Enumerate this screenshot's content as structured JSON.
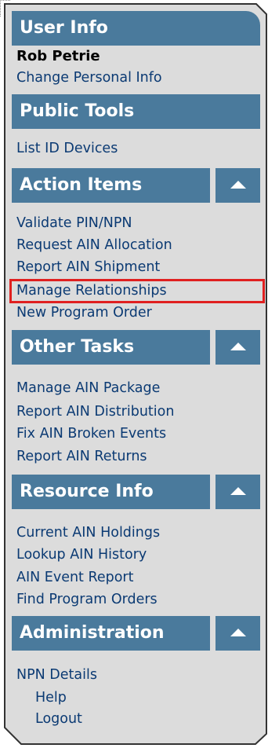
{
  "sections": {
    "user_info": {
      "title": "User Info",
      "user_name": "Rob Petrie",
      "links": [
        "Change Personal Info"
      ]
    },
    "public_tools": {
      "title": "Public Tools",
      "links": [
        "List ID Devices"
      ]
    },
    "action_items": {
      "title": "Action Items",
      "links": [
        "Validate PIN/NPN",
        "Request AIN Allocation",
        "Report AIN Shipment",
        "Manage Relationships",
        "New Program Order"
      ]
    },
    "other_tasks": {
      "title": "Other Tasks",
      "links": [
        "Manage AIN Package",
        "Report AIN Distribution",
        "Fix AIN Broken Events",
        "Report AIN Returns"
      ]
    },
    "resource_info": {
      "title": "Resource Info",
      "links": [
        "Current AIN Holdings",
        "Lookup AIN History",
        "AIN Event Report",
        "Find Program Orders"
      ]
    },
    "administration": {
      "title": "Administration",
      "links": [
        "NPN Details",
        "Help",
        "Logout"
      ]
    }
  },
  "colors": {
    "header_bg": "#4a7a9c",
    "panel_bg": "#dcdcdc",
    "link_text": "#0b3a73",
    "highlight": "#e02020"
  }
}
